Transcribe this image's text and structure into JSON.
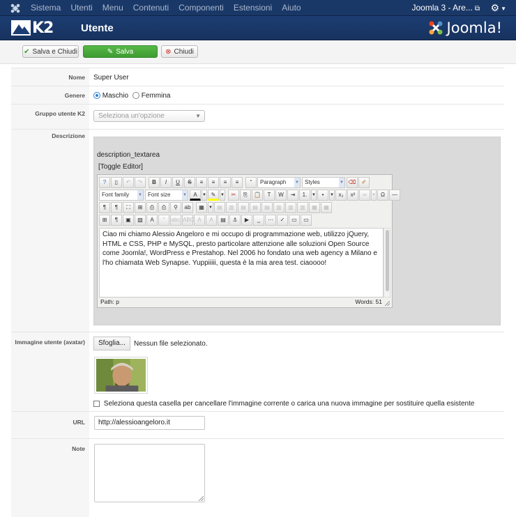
{
  "topnav": {
    "menu": [
      "Sistema",
      "Utenti",
      "Menu",
      "Contenuti",
      "Componenti",
      "Estensioni",
      "Aiuto"
    ],
    "site_name": "Joomla 3 - Are...",
    "site_icon": "external-link-icon",
    "settings_icon": "gear-icon"
  },
  "header": {
    "logo_text": "K2",
    "title": "Utente",
    "brand": "Joomla!"
  },
  "toolbar": {
    "save_close": "Salva e Chiudi",
    "save": "Salva",
    "close": "Chiudi"
  },
  "form": {
    "name_label": "Nome",
    "name_value": "Super User",
    "gender_label": "Genere",
    "gender_male": "Maschio",
    "gender_female": "Femmina",
    "gender_selected": "Maschio",
    "group_label": "Gruppo utente K2",
    "group_placeholder": "Seleziona un'opzione",
    "description_label": "Descrizione",
    "textarea_name": "description_textarea",
    "toggle_editor": "[Toggle Editor]",
    "editor": {
      "format_select": "Paragraph",
      "styles_select": "Styles",
      "font_family_select": "Font family",
      "font_size_select": "Font size",
      "content": "Ciao mi chiamo Alessio Angeloro e mi occupo di programmazione web, utilizzo jQuery, HTML e CSS, PHP e MySQL, presto particolare attenzione alle soluzioni Open Source come Joomla!, WordPress e Prestahop. Nel 2006 ho fondato una web agency a Milano e l'ho chiamata Web Synapse. Yuppiiiii, questa è la mia area test. ciaoooo!",
      "path_label": "Path:",
      "path_value": "p",
      "words_label": "Words:",
      "words_value": "51"
    },
    "avatar_label": "Immagine utente (avatar)",
    "browse_button": "Sfoglia...",
    "no_file": "Nessun file selezionato.",
    "delete_image_text": "Seleziona questa casella per cancellare l'immagine corrente o carica una nuova immagine per sostituire quella esistente",
    "url_label": "URL",
    "url_value": "http://alessioangeloro.it",
    "notes_label": "Note"
  },
  "colors": {
    "topnav_bg": "#1a3867",
    "header_bg": "#1c3d73",
    "save_green": "#46a737",
    "accent_blue": "#2a7fd6"
  }
}
